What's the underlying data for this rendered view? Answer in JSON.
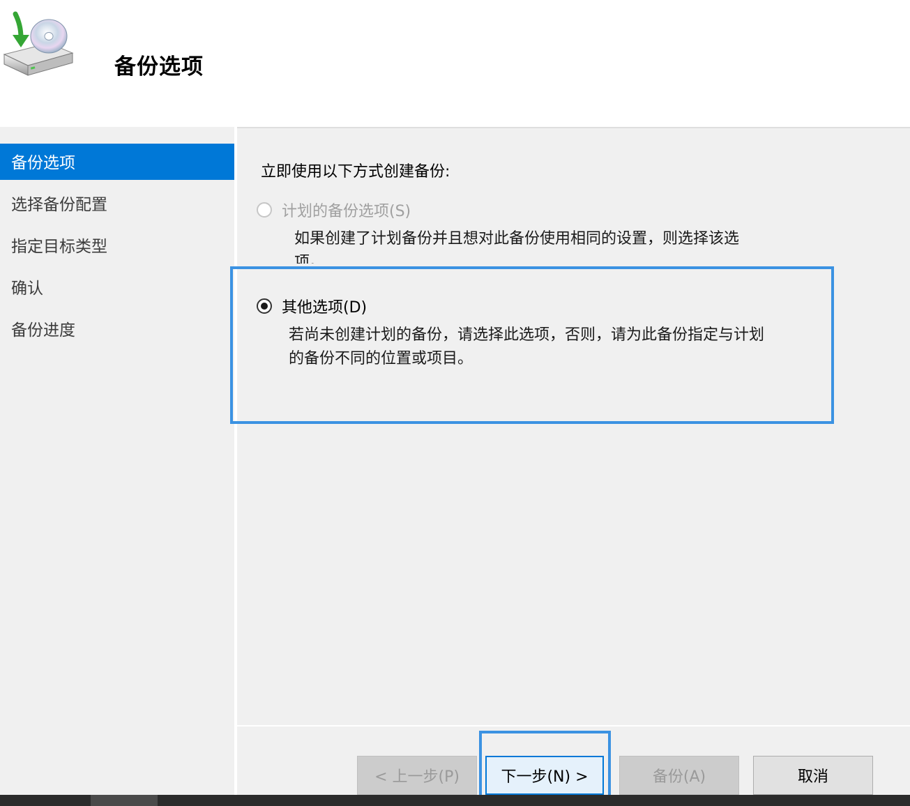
{
  "header": {
    "title": "备份选项",
    "icon": "backup-drive-icon"
  },
  "sidebar": {
    "items": [
      {
        "label": "备份选项",
        "active": true
      },
      {
        "label": "选择备份配置",
        "active": false
      },
      {
        "label": "指定目标类型",
        "active": false
      },
      {
        "label": "确认",
        "active": false
      },
      {
        "label": "备份进度",
        "active": false
      }
    ]
  },
  "main": {
    "intro": "立即使用以下方式创建备份:",
    "options": [
      {
        "label": "计划的备份选项(S)",
        "description": "如果创建了计划备份并且想对此备份使用相同的设置，则选择该选项。",
        "checked": false,
        "enabled": false
      },
      {
        "label": "其他选项(D)",
        "description": "若尚未创建计划的备份，请选择此选项，否则，请为此备份指定与计划的备份不同的位置或项目。",
        "checked": true,
        "enabled": true
      }
    ]
  },
  "footer": {
    "prev_label": "< 上一步(P)",
    "next_label": "下一步(N) >",
    "backup_label": "备份(A)",
    "cancel_label": "取消"
  },
  "colors": {
    "accent": "#0078d7",
    "highlight": "#3b92e2",
    "panel": "#f0f0f0"
  }
}
